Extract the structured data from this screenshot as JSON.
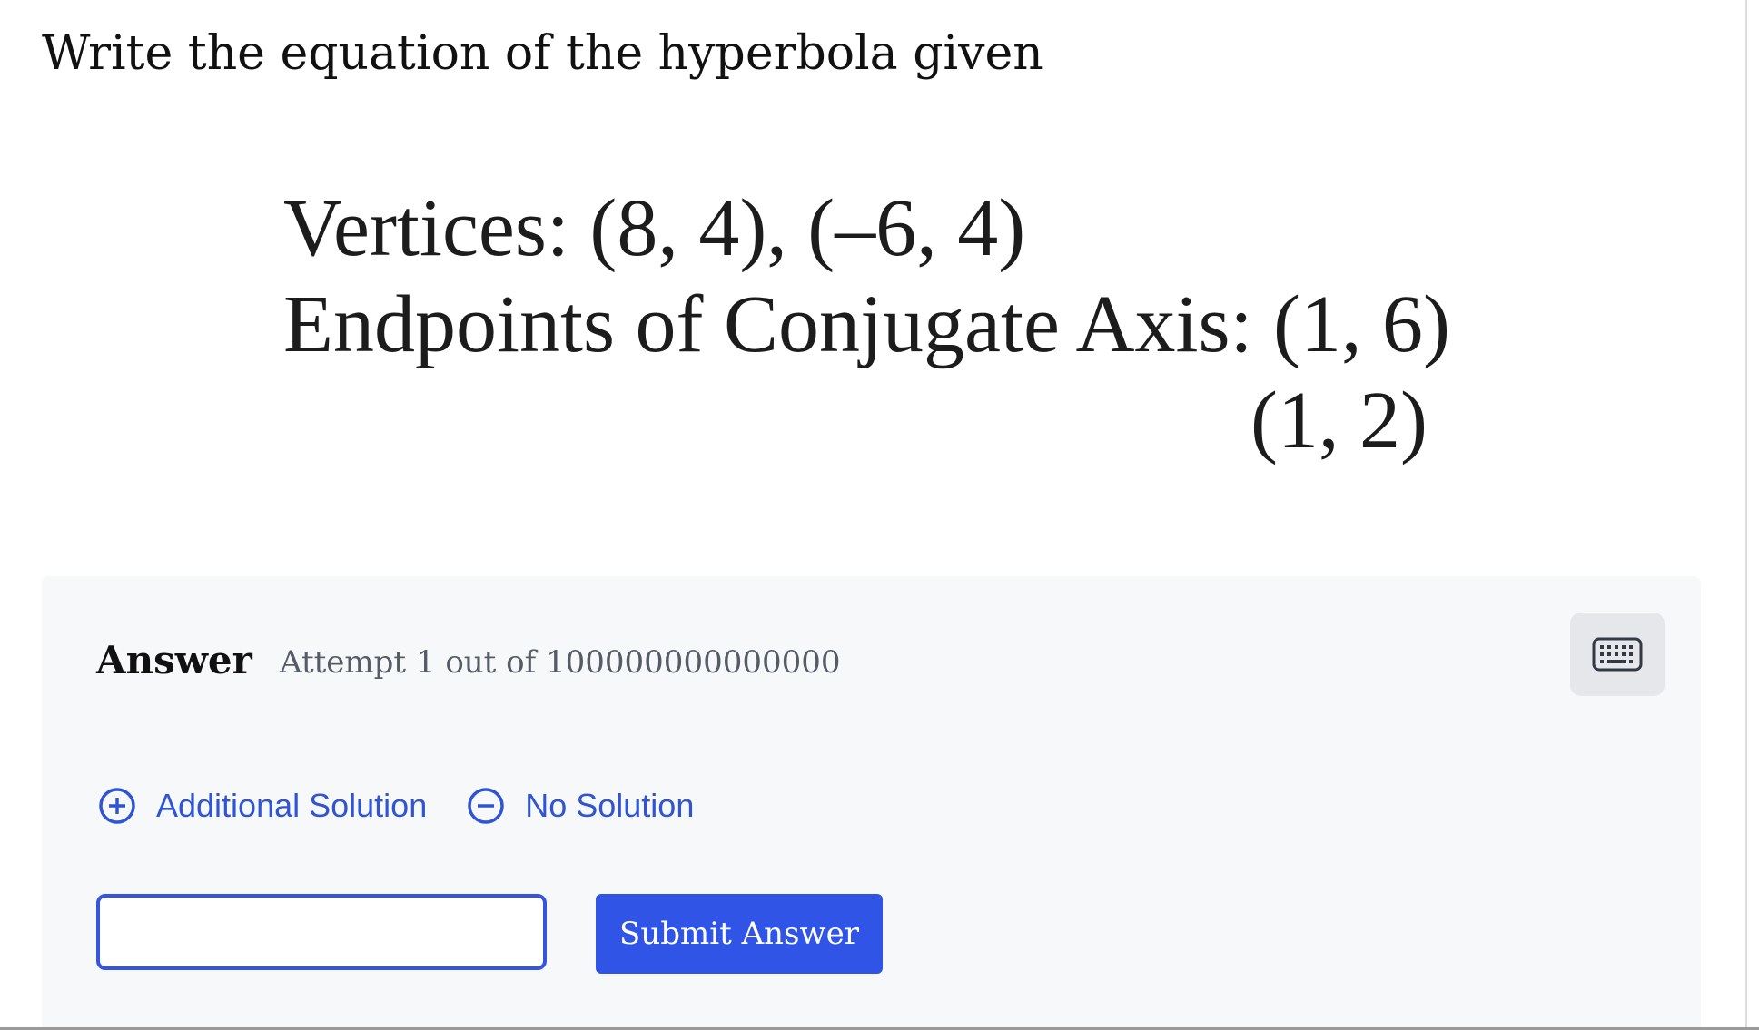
{
  "question": {
    "prompt": "Write the equation of the hyperbola given"
  },
  "figure": {
    "vertices_line": "Vertices: (8, 4), (–6, 4)",
    "conjugate_line": "Endpoints of Conjugate Axis: (1, 6)",
    "conjugate_second_point": "(1, 2)"
  },
  "answer": {
    "title": "Answer",
    "attempt": "Attempt 1 out of 100000000000000",
    "keyboard_icon": "keyboard-icon",
    "options": {
      "additional_solution": "Additional Solution",
      "no_solution": "No Solution"
    },
    "input_value": "",
    "submit_label": "Submit Answer"
  },
  "colors": {
    "accent": "#3055e6",
    "link": "#2f55d4",
    "panel_bg": "#f7f8fa"
  }
}
